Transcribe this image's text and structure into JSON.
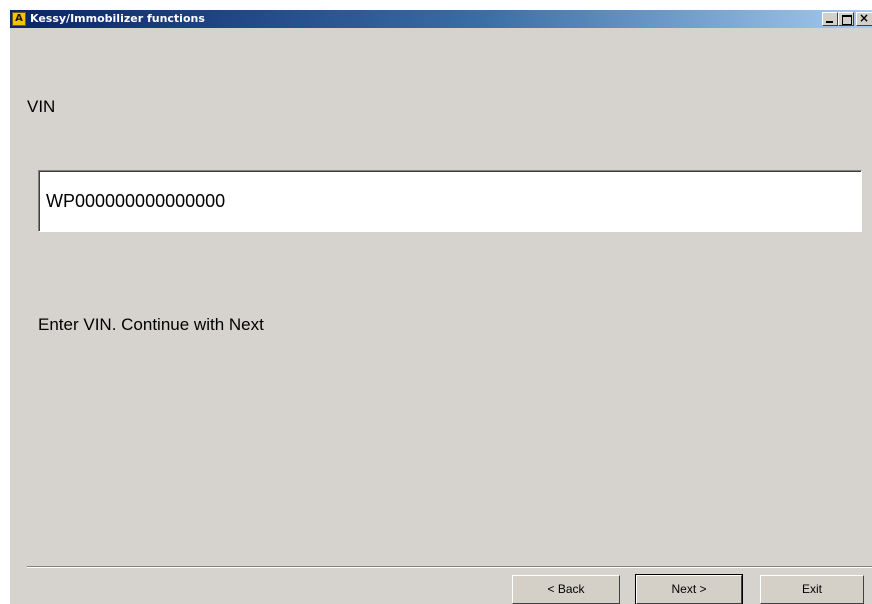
{
  "window": {
    "title": "Kessy/Immobilizer functions",
    "icon_letter": "A",
    "controls": {
      "minimize": "minimize-icon",
      "maximize": "maximize-icon",
      "close": "close-icon"
    }
  },
  "form": {
    "vin_label": "VIN",
    "vin_value": "WP000000000000000",
    "instruction": "Enter VIN. Continue with Next"
  },
  "buttons": {
    "back": "< Back",
    "next": "Next >",
    "exit": "Exit"
  },
  "colors": {
    "face": "#d6d3ce",
    "titlebar_start": "#0a246a",
    "titlebar_end": "#a6caf0",
    "icon_yellow": "#f5c400"
  }
}
